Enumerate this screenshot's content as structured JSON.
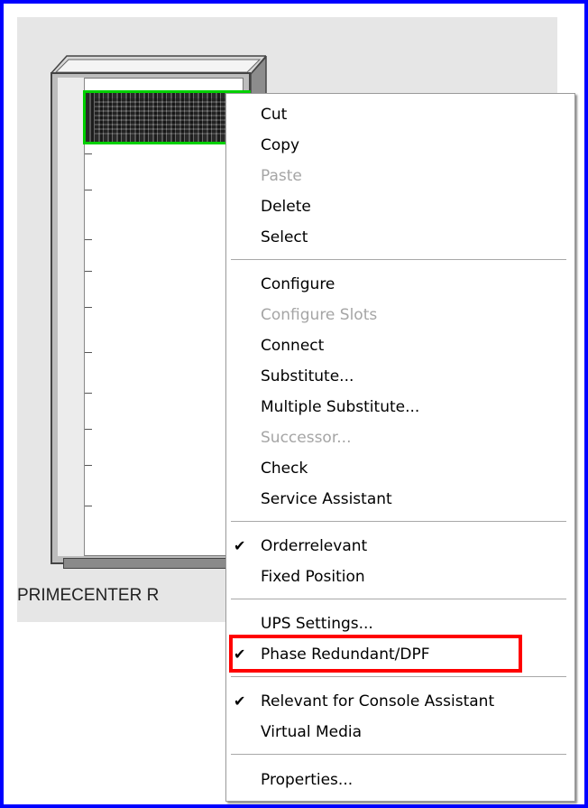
{
  "rack": {
    "label": "PRIMECENTER R"
  },
  "menu": {
    "group1": [
      {
        "label": "Cut",
        "enabled": true,
        "checked": false
      },
      {
        "label": "Copy",
        "enabled": true,
        "checked": false
      },
      {
        "label": "Paste",
        "enabled": false,
        "checked": false
      },
      {
        "label": "Delete",
        "enabled": true,
        "checked": false
      },
      {
        "label": "Select",
        "enabled": true,
        "checked": false
      }
    ],
    "group2": [
      {
        "label": "Configure",
        "enabled": true,
        "checked": false
      },
      {
        "label": "Configure Slots",
        "enabled": false,
        "checked": false
      },
      {
        "label": "Connect",
        "enabled": true,
        "checked": false
      },
      {
        "label": "Substitute...",
        "enabled": true,
        "checked": false
      },
      {
        "label": "Multiple Substitute...",
        "enabled": true,
        "checked": false
      },
      {
        "label": "Successor...",
        "enabled": false,
        "checked": false
      },
      {
        "label": "Check",
        "enabled": true,
        "checked": false
      },
      {
        "label": "Service Assistant",
        "enabled": true,
        "checked": false
      }
    ],
    "group3": [
      {
        "label": "Orderrelevant",
        "enabled": true,
        "checked": true
      },
      {
        "label": "Fixed Position",
        "enabled": true,
        "checked": false
      }
    ],
    "group4": [
      {
        "label": "UPS Settings...",
        "enabled": true,
        "checked": false
      },
      {
        "label": "Phase Redundant/DPF",
        "enabled": true,
        "checked": true
      }
    ],
    "group5": [
      {
        "label": "Relevant for Console Assistant",
        "enabled": true,
        "checked": true
      },
      {
        "label": "Virtual Media",
        "enabled": true,
        "checked": false
      }
    ],
    "group6": [
      {
        "label": "Properties...",
        "enabled": true,
        "checked": false
      }
    ],
    "check_glyph": "✔"
  },
  "colors": {
    "frame": "#0000ff",
    "selection": "#00d000",
    "highlight": "#ff0000",
    "disabled_text": "#a5a5a5"
  }
}
